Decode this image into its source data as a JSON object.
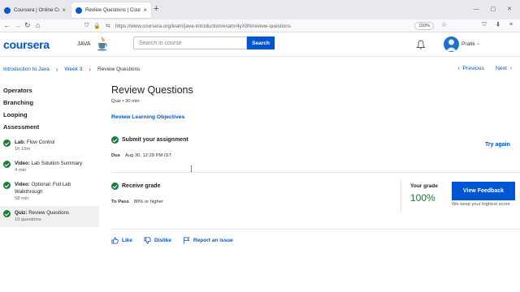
{
  "browser": {
    "tabs": [
      {
        "label": "Coursera | Online Courses & Cr",
        "active": false
      },
      {
        "label": "Review Questions | Coursera",
        "active": true
      }
    ],
    "url": "https://www.coursera.org/learn/java-introduction/exam/4yX8N/review-questions",
    "zoom": "110%"
  },
  "header": {
    "logo": "coursera",
    "course_label": "JAVA",
    "search_placeholder": "Search in course",
    "search_button": "Search",
    "user_name": "Pratik"
  },
  "breadcrumbs": [
    "Introduction to Java",
    "Week 3",
    "Review Questions"
  ],
  "pager": {
    "previous": "Previous",
    "next": "Next"
  },
  "sidebar": {
    "sections": [
      "Operators",
      "Branching",
      "Looping",
      "Assessment"
    ],
    "items": [
      {
        "type": "Lab:",
        "title": "Flow Control",
        "sub": "1h 15m"
      },
      {
        "type": "Video:",
        "title": "Lab Solution Summary",
        "sub": "4 min"
      },
      {
        "type": "Video:",
        "title": "Optional: Full Lab Walkthrough",
        "sub": "58 min"
      },
      {
        "type": "Quiz:",
        "title": "Review Questions",
        "sub": "10 questions"
      }
    ]
  },
  "main": {
    "title": "Review Questions",
    "meta": "Quiz • 30 min",
    "review_objectives": "Review Learning Objectives",
    "submit_title": "Submit your assignment",
    "due_label": "Due",
    "due_value": "Aug 30, 12:29 PM IST",
    "try_again": "Try again",
    "receive_grade": "Receive grade",
    "to_pass_label": "To Pass",
    "to_pass_value": "80% or higher",
    "your_grade_label": "Your grade",
    "your_grade_value": "100%",
    "view_feedback": "View Feedback",
    "keep_note": "We keep your highest score"
  },
  "actions": {
    "like": "Like",
    "dislike": "Dislike",
    "report": "Report an issue"
  },
  "colors": {
    "brand": "#0056d2",
    "success": "#1e7b3a"
  }
}
